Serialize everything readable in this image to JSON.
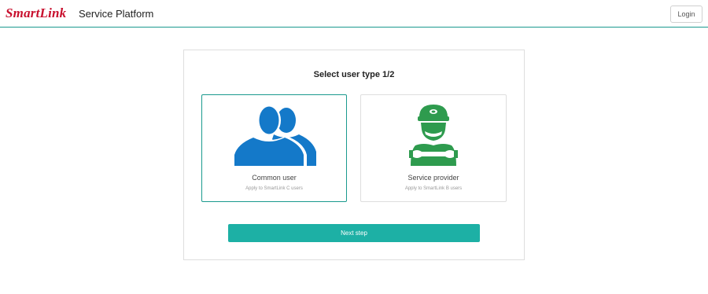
{
  "header": {
    "logo_text": "SmartLink",
    "title": "Service Platform",
    "login_label": "Login"
  },
  "panel": {
    "title": "Select user type 1/2",
    "cards": [
      {
        "label": "Common user",
        "subtitle": "Apply to SmartLink C users",
        "icon": "users-icon",
        "selected": true
      },
      {
        "label": "Service provider",
        "subtitle": "Apply to SmartLink B users",
        "icon": "technician-icon",
        "selected": false
      }
    ],
    "next_label": "Next step"
  },
  "colors": {
    "accent": "#1db0a5",
    "brand_red": "#c8102e",
    "user_icon_blue": "#1479c9",
    "provider_icon_green": "#2e9b4e"
  }
}
